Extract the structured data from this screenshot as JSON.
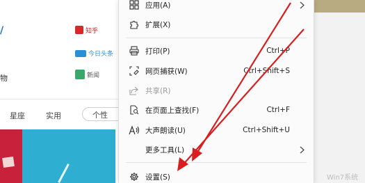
{
  "background": {
    "left_snippets": [
      "/",
      "物"
    ],
    "logo_b_text": "知乎",
    "logo_c_text": "今日头条",
    "logo_d_text": "新闻",
    "tabs": [
      "星座",
      "实用"
    ],
    "chip_label": "个性",
    "watermark": "Win7系统"
  },
  "menu": {
    "items": [
      {
        "label": "应用(A)",
        "shortcut": "",
        "icon": "apps-icon",
        "submenu": true
      },
      {
        "label": "扩展(X)",
        "shortcut": "",
        "icon": "puzzle-icon",
        "submenu": false
      },
      {
        "label": "打印(P)",
        "shortcut": "Ctrl+P",
        "icon": "printer-icon",
        "submenu": false
      },
      {
        "label": "网页捕获(W)",
        "shortcut": "Ctrl+Shift+S",
        "icon": "web-capture-icon",
        "submenu": false
      },
      {
        "label": "共享(R)",
        "shortcut": "",
        "icon": "share-icon",
        "submenu": false,
        "disabled": true
      },
      {
        "label": "在页面上查找(F)",
        "shortcut": "Ctrl+F",
        "icon": "find-icon",
        "submenu": false
      },
      {
        "label": "大声朗读(U)",
        "shortcut": "Ctrl+Shift+U",
        "icon": "read-aloud-icon",
        "submenu": false
      },
      {
        "label": "更多工具(L)",
        "shortcut": "",
        "icon": "",
        "submenu": true
      },
      {
        "label": "设置(S)",
        "shortcut": "",
        "icon": "gear-icon",
        "submenu": false
      }
    ]
  },
  "colors": {
    "arrow": "#d81e1e",
    "menu_bg": "#fbfbfb",
    "card_red": "#c8213b",
    "card_blue": "#2eaed0"
  }
}
